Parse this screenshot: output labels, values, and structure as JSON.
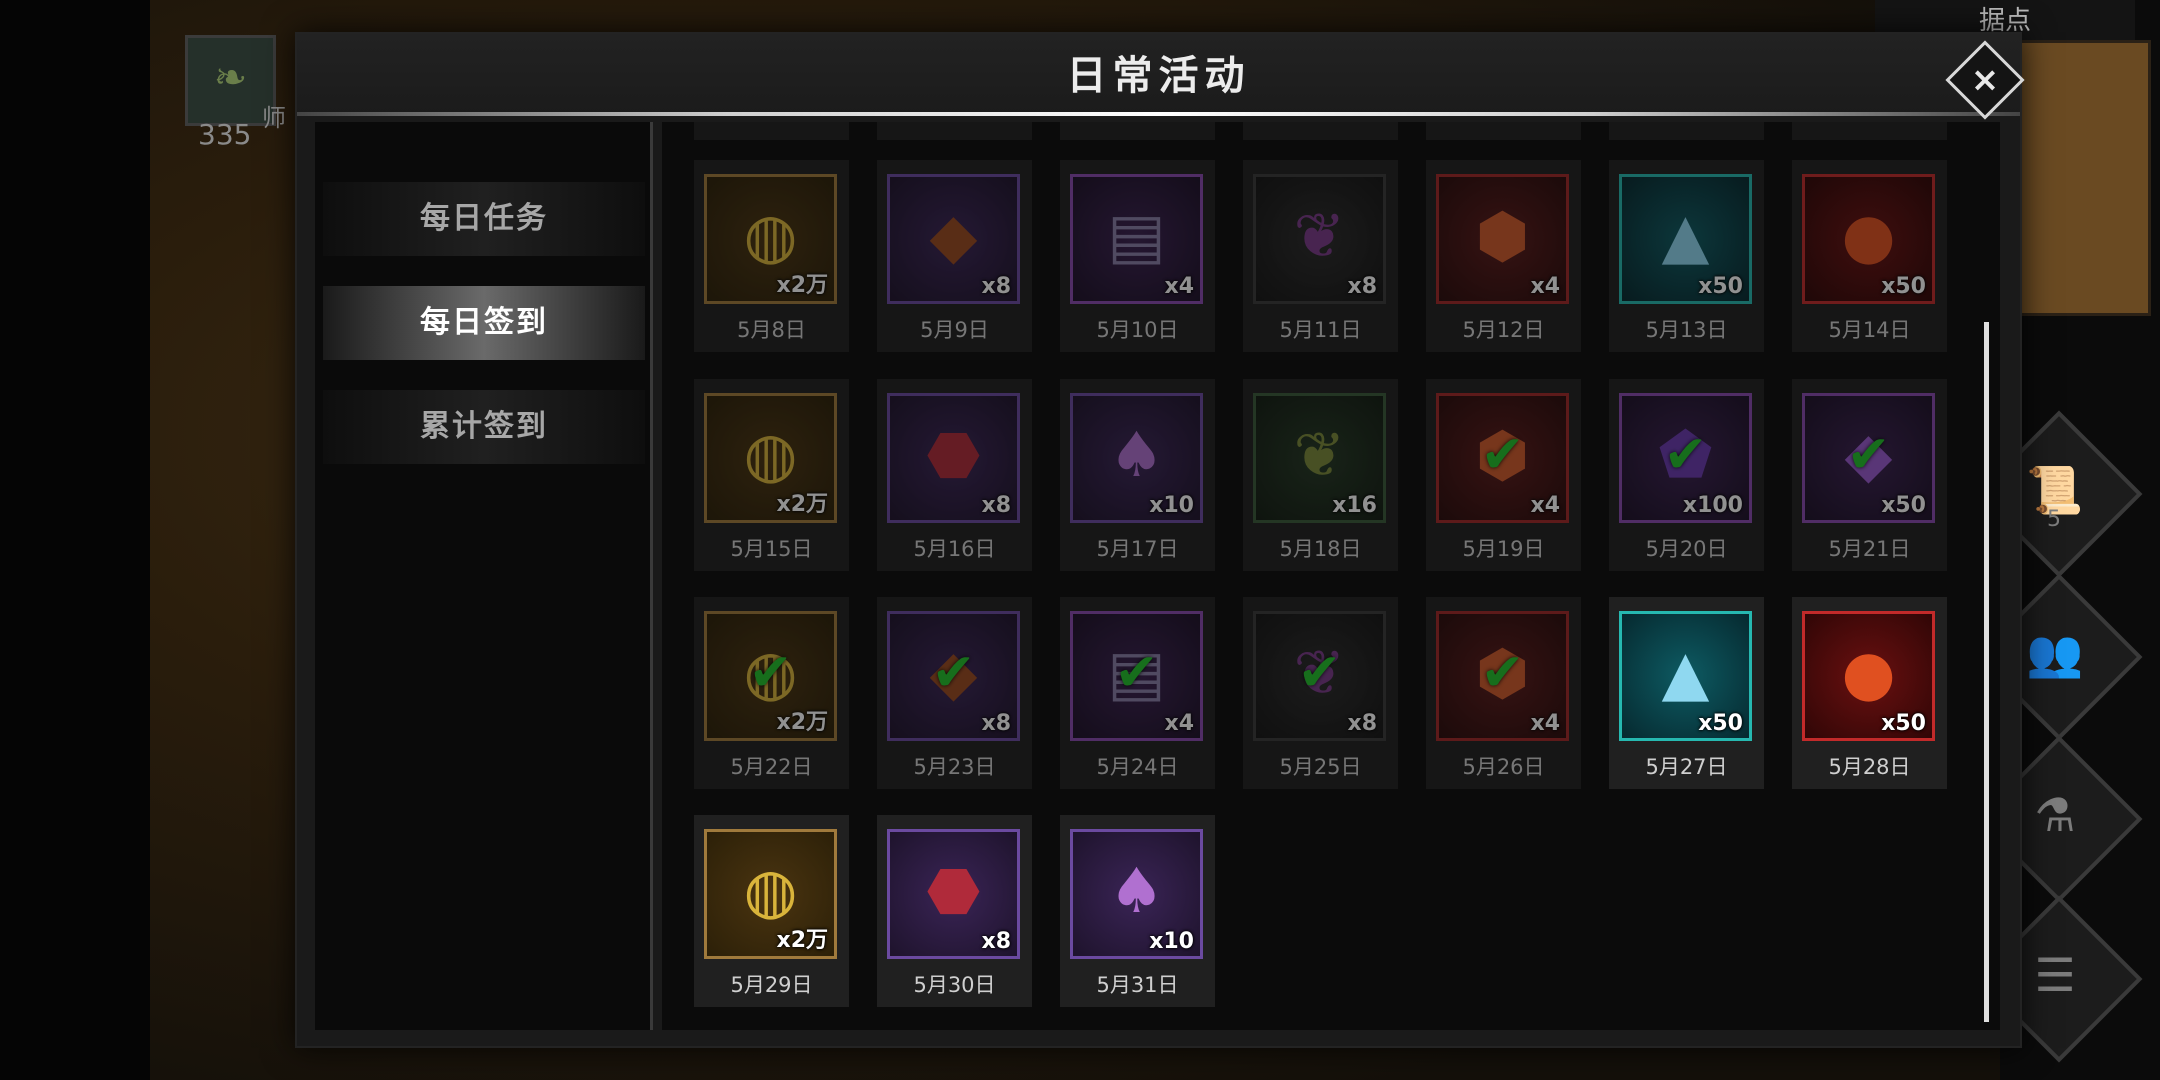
{
  "hud": {
    "map_label": "据点",
    "player_value": "335",
    "player_name": "师",
    "quest_count": "5",
    "icons": [
      "scroll-icon",
      "group-icon",
      "potion-icon",
      "list-icon"
    ]
  },
  "panel": {
    "title": "日常活动",
    "close_label": "×"
  },
  "sidebar": {
    "items": [
      {
        "label": "每日任务",
        "active": false
      },
      {
        "label": "每日签到",
        "active": true
      },
      {
        "label": "累计签到",
        "active": false
      }
    ]
  },
  "rewards": [
    {
      "date": "5月8日",
      "qty": "x2万",
      "item": "gold-coins",
      "frame": "gold",
      "glyph": "◍",
      "color": "gold",
      "claimed": false,
      "dim": true
    },
    {
      "date": "5月9日",
      "qty": "x8",
      "item": "leather-bracer",
      "frame": "purple",
      "glyph": "◆",
      "color": "brown",
      "claimed": false,
      "dim": true
    },
    {
      "date": "5月10日",
      "qty": "x4",
      "item": "book",
      "frame": "violet",
      "glyph": "▤",
      "color": "book",
      "claimed": false,
      "dim": true
    },
    {
      "date": "5月11日",
      "qty": "x8",
      "item": "feather",
      "frame": "dark",
      "glyph": "❦",
      "color": "feather",
      "claimed": false,
      "dim": true
    },
    {
      "date": "5月12日",
      "qty": "x4",
      "item": "amber-gem",
      "frame": "red",
      "glyph": "⬢",
      "color": "gem",
      "claimed": false,
      "dim": true
    },
    {
      "date": "5月13日",
      "qty": "x50",
      "item": "crystal-prism",
      "frame": "teal",
      "glyph": "▲",
      "color": "crystal",
      "claimed": false,
      "dim": true
    },
    {
      "date": "5月14日",
      "qty": "x50",
      "item": "fire-orb",
      "frame": "crimson",
      "glyph": "●",
      "color": "fire",
      "claimed": false,
      "dim": true
    },
    {
      "date": "5月15日",
      "qty": "x2万",
      "item": "gold-coins",
      "frame": "gold",
      "glyph": "◍",
      "color": "gold",
      "claimed": false,
      "dim": true
    },
    {
      "date": "5月16日",
      "qty": "x8",
      "item": "ruby-ore",
      "frame": "purple",
      "glyph": "⬣",
      "color": "ruby",
      "claimed": false,
      "dim": true
    },
    {
      "date": "5月17日",
      "qty": "x10",
      "item": "purple-shards",
      "frame": "purple",
      "glyph": "♠",
      "color": "shard",
      "claimed": false,
      "dim": true
    },
    {
      "date": "5月18日",
      "qty": "x16",
      "item": "seed-pod",
      "frame": "green",
      "glyph": "❦",
      "color": "pod",
      "claimed": false,
      "dim": true
    },
    {
      "date": "5月19日",
      "qty": "x4",
      "item": "amber-crystal",
      "frame": "red",
      "glyph": "⬢",
      "color": "gem",
      "claimed": true,
      "dim": true
    },
    {
      "date": "5月20日",
      "qty": "x100",
      "item": "dark-crystal",
      "frame": "violet",
      "glyph": "⬟",
      "color": "dark",
      "claimed": true,
      "dim": true
    },
    {
      "date": "5月21日",
      "qty": "x50",
      "item": "amethyst",
      "frame": "violet",
      "glyph": "◆",
      "color": "amethyst",
      "claimed": true,
      "dim": true
    },
    {
      "date": "5月22日",
      "qty": "x2万",
      "item": "gold-coins",
      "frame": "gold",
      "glyph": "◍",
      "color": "gold",
      "claimed": true,
      "dim": true
    },
    {
      "date": "5月23日",
      "qty": "x8",
      "item": "leather-bracer",
      "frame": "purple",
      "glyph": "◆",
      "color": "brown",
      "claimed": true,
      "dim": true
    },
    {
      "date": "5月24日",
      "qty": "x4",
      "item": "book",
      "frame": "violet",
      "glyph": "▤",
      "color": "book",
      "claimed": true,
      "dim": true
    },
    {
      "date": "5月25日",
      "qty": "x8",
      "item": "feather",
      "frame": "dark",
      "glyph": "❦",
      "color": "feather",
      "claimed": true,
      "dim": true
    },
    {
      "date": "5月26日",
      "qty": "x4",
      "item": "amber-gem",
      "frame": "red",
      "glyph": "⬢",
      "color": "gem",
      "claimed": true,
      "dim": true
    },
    {
      "date": "5月27日",
      "qty": "x50",
      "item": "crystal-prism",
      "frame": "teal",
      "glyph": "▲",
      "color": "crystal",
      "claimed": false,
      "dim": false
    },
    {
      "date": "5月28日",
      "qty": "x50",
      "item": "fire-orb",
      "frame": "crimson",
      "glyph": "●",
      "color": "fire",
      "claimed": false,
      "dim": false
    },
    {
      "date": "5月29日",
      "qty": "x2万",
      "item": "gold-coins",
      "frame": "gold",
      "glyph": "◍",
      "color": "gold",
      "claimed": false,
      "dim": false
    },
    {
      "date": "5月30日",
      "qty": "x8",
      "item": "ruby-ore",
      "frame": "purple",
      "glyph": "⬣",
      "color": "ruby",
      "claimed": false,
      "dim": false
    },
    {
      "date": "5月31日",
      "qty": "x10",
      "item": "purple-shards",
      "frame": "purple",
      "glyph": "♠",
      "color": "shard",
      "claimed": false,
      "dim": false
    }
  ],
  "check_glyph": "✔"
}
